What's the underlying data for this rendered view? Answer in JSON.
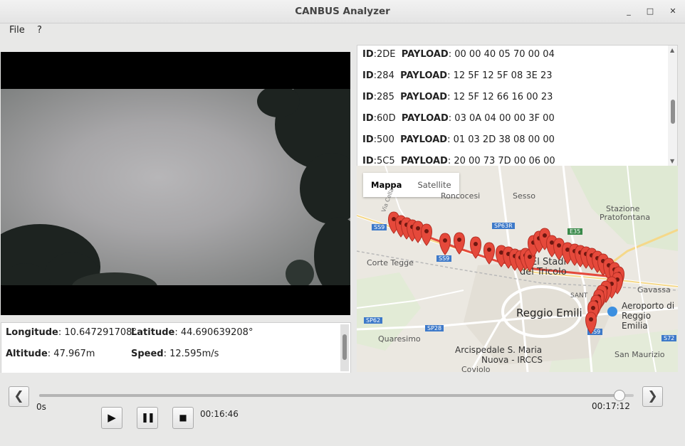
{
  "window": {
    "title": "CANBUS Analyzer",
    "minimize": "_",
    "maximize": "□",
    "close": "✕"
  },
  "menu": {
    "items": [
      "File",
      "?"
    ]
  },
  "telemetry": {
    "longitude_label": "Longitude",
    "longitude_value": ": 10.647291708°",
    "latitude_label": "Latitude",
    "latitude_value": ": 44.690639208°",
    "altitude_label": "Altitude",
    "altitude_value": ": 47.967m",
    "speed_label": "Speed",
    "speed_value": ": 12.595m/s"
  },
  "can_log": [
    {
      "id_label": "ID",
      "id": ":2DE",
      "payload_label": "PAYLOAD",
      "payload": ": 00 00 40 05 70 00 04"
    },
    {
      "id_label": "ID",
      "id": ":284",
      "payload_label": "PAYLOAD",
      "payload": ": 12 5F 12 5F 08 3E 23"
    },
    {
      "id_label": "ID",
      "id": ":285",
      "payload_label": "PAYLOAD",
      "payload": ": 12 5F 12 66 16 00 23"
    },
    {
      "id_label": "ID",
      "id": ":60D",
      "payload_label": "PAYLOAD",
      "payload": ": 03 0A 04 00 00 3F 00"
    },
    {
      "id_label": "ID",
      "id": ":500",
      "payload_label": "PAYLOAD",
      "payload": ": 01 03 2D 38 08 00 00"
    },
    {
      "id_label": "ID",
      "id": ":5C5",
      "payload_label": "PAYLOAD",
      "payload": ": 20 00 73 7D 00 06 00"
    }
  ],
  "map": {
    "type_map": "Mappa",
    "type_satellite": "Satellite",
    "places": {
      "roncocesi": "Roncocesi",
      "sesso": "Sesso",
      "stazione": "Stazione",
      "pratofontana": "Pratofontana",
      "corte_tegge": "Corte Tegge",
      "stadio1": "El Stadi",
      "stadio2": "del Tricolo",
      "gavassa": "Gavassa",
      "aeroporto1": "Aeroporto di",
      "aeroporto2": "Reggio Emilia",
      "reggio": "Reggio Emili",
      "quaresimo": "Quaresimo",
      "ospedale1": "Arcispedale S. Maria",
      "ospedale2": "Nuova - IRCCS",
      "coviolo": "Coviolo",
      "san_maurizio": "San Maurizio",
      "santo": "SANT",
      "via_cella": "Via Cella"
    },
    "roads": {
      "ss9a": "SS9",
      "ss9b": "SS9",
      "ss9c": "SS9",
      "sp63r": "SP63R",
      "e35": "E35",
      "sp62": "SP62",
      "sp28": "SP28",
      "s72": "S72"
    },
    "pin_color": "#e5493b",
    "route_color": "#e5493b"
  },
  "player": {
    "prev": "❮",
    "next": "❯",
    "start_time": "0s",
    "end_time": "00:17:12",
    "current_time": "00:16:46",
    "progress": 0.975,
    "play": "▶",
    "pause": "❚❚",
    "stop": "■"
  }
}
